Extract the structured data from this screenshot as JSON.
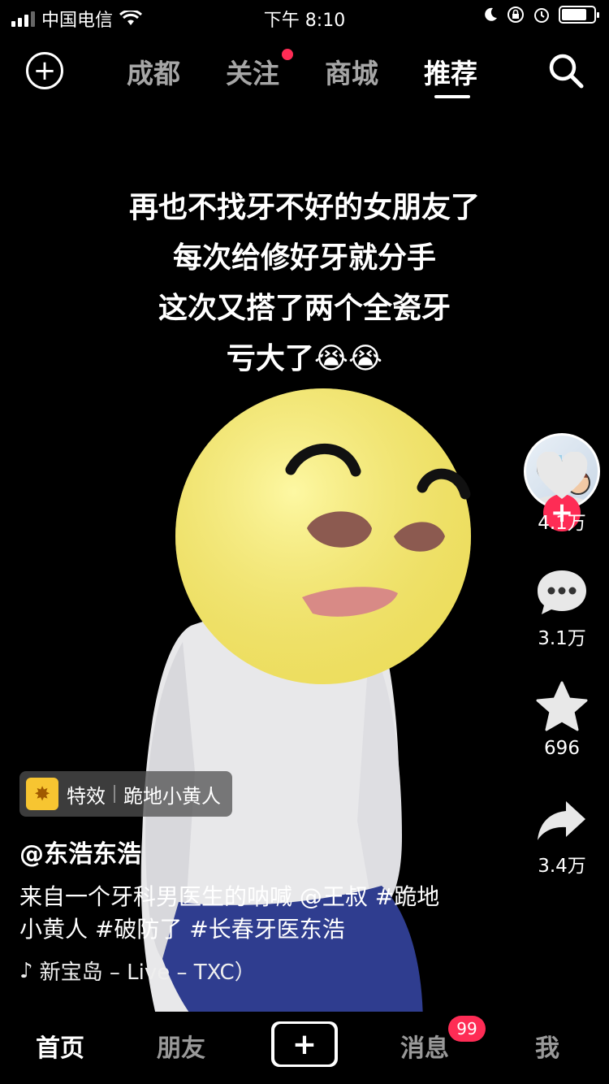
{
  "status_bar": {
    "carrier": "中国电信",
    "time": "下午 8:10"
  },
  "top_nav": {
    "tabs": [
      "成都",
      "关注",
      "商城",
      "推荐"
    ],
    "active_tab": "推荐"
  },
  "video": {
    "overlay_lines": [
      "再也不找牙不好的女朋友了",
      "每次给修好牙就分手",
      "这次又搭了两个全瓷牙",
      "亏大了😭😭"
    ]
  },
  "right_rail": {
    "likes": "4.1万",
    "comments": "3.1万",
    "favorites": "696",
    "shares": "3.4万"
  },
  "info": {
    "effect_label": "特效",
    "effect_name": "跪地小黄人",
    "author": "@东浩东浩",
    "description": "来自一个牙科男医生的呐喊 @王叔 #跪地小黄人 #破防了 #长春牙医东浩",
    "music": "新宝岛 – Live – TXC）"
  },
  "bottom_bar": {
    "tabs": [
      "首页",
      "朋友",
      "消息",
      "我"
    ],
    "active_tab": "首页",
    "messages_badge": "99"
  },
  "colors": {
    "accent": "#fe2c55",
    "emoji_yellow": "#f7ec6e",
    "pants_blue": "#2f3d8f"
  }
}
